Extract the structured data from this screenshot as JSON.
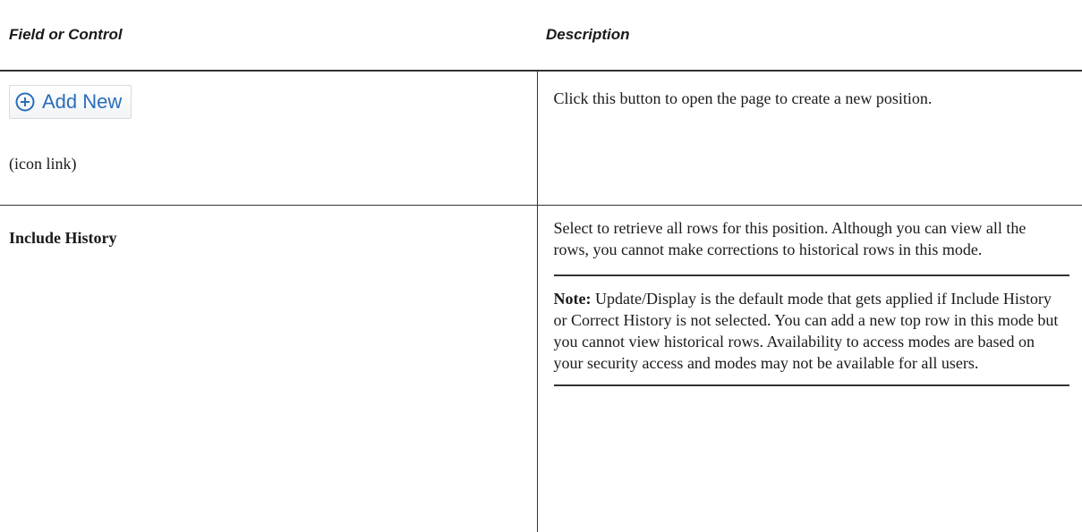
{
  "table": {
    "headers": {
      "field": "Field or Control",
      "description": "Description"
    },
    "rows": [
      {
        "button": {
          "label": "Add New",
          "icon": "plus-circle-icon",
          "color": "#2a6ebb"
        },
        "caption": "(icon link)",
        "description": "Click this button to open the page to create a new position."
      },
      {
        "field": "Include History",
        "description": "Select to retrieve all rows for this position. Although you can view all the rows, you cannot make corrections to historical rows in this mode.",
        "note": {
          "label": "Note:",
          "text": " Update/Display is the default mode that gets applied if Include History or Correct History is not selected. You can add a new top row in this mode but you cannot view historical rows. Availability to access modes are based on your security access and modes may not be available for all users."
        }
      }
    ]
  }
}
